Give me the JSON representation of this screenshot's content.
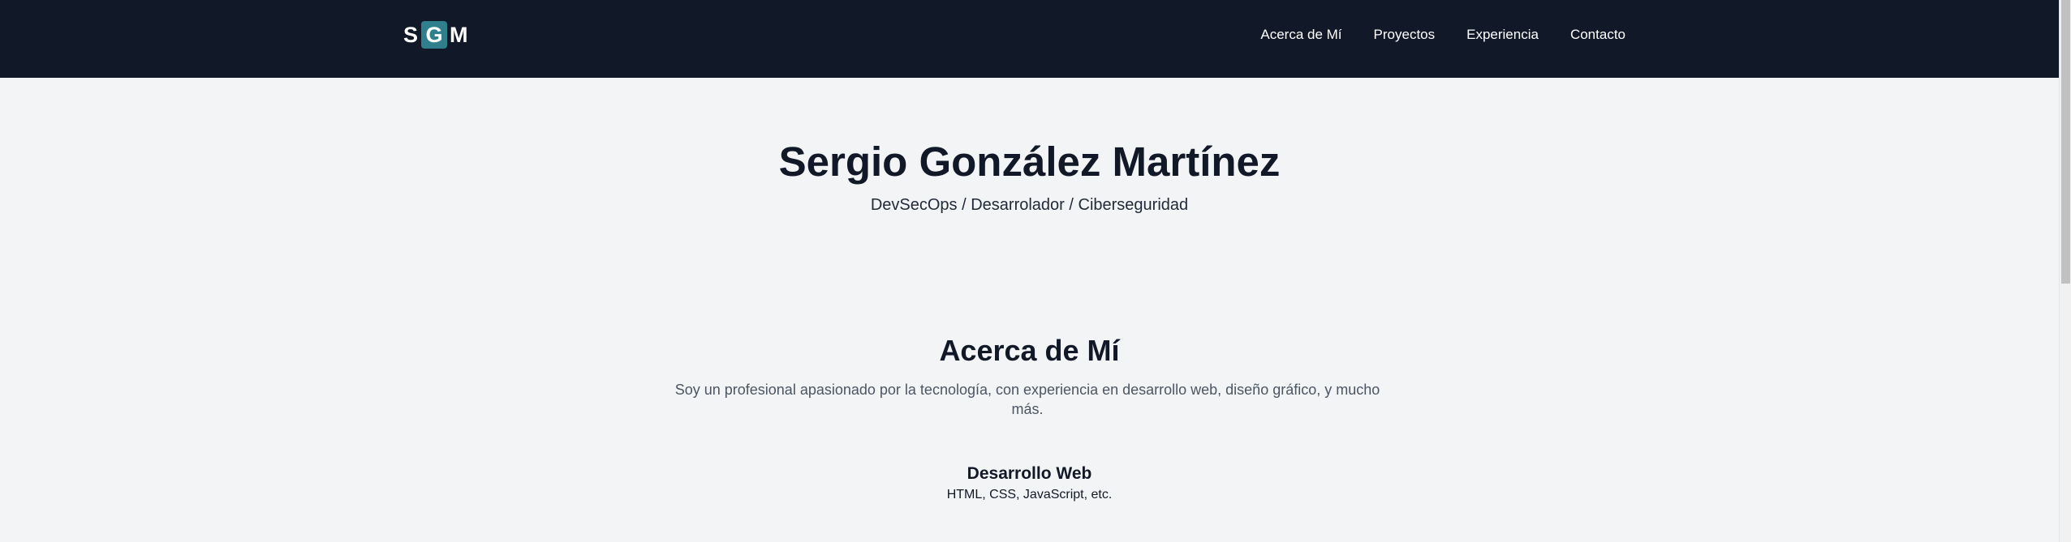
{
  "logo": {
    "letter1": "S",
    "letter2": "G",
    "letter3": "M",
    "highlight_color": "#2f7f8c"
  },
  "nav": {
    "items": [
      {
        "label": "Acerca de Mí"
      },
      {
        "label": "Proyectos"
      },
      {
        "label": "Experiencia"
      },
      {
        "label": "Contacto"
      }
    ]
  },
  "hero": {
    "title": "Sergio González Martínez",
    "subtitle": "DevSecOps / Desarrolador / Ciberseguridad"
  },
  "about": {
    "title": "Acerca de Mí",
    "description": "Soy un profesional apasionado por la tecnología, con experiencia en desarrollo web, diseño gráfico, y mucho más.",
    "skills": [
      {
        "title": "Desarrollo Web",
        "description": "HTML, CSS, JavaScript, etc."
      }
    ]
  },
  "colors": {
    "navbar": "#111827",
    "background": "#f3f4f6",
    "accent": "#2f7f8c"
  }
}
